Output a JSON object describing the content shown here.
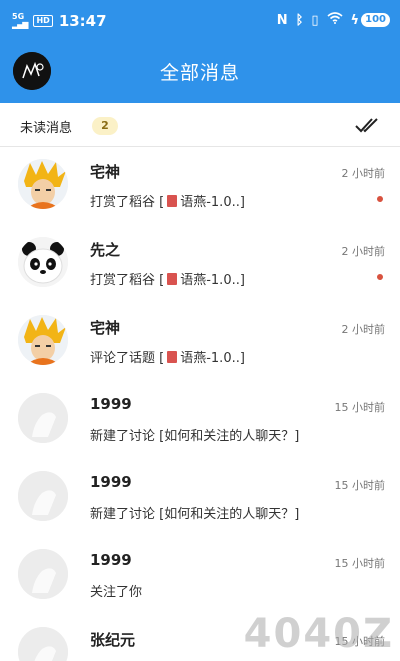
{
  "status_bar": {
    "network": "5G",
    "hd": "HD",
    "time": "13:47",
    "icons": [
      "nfc-icon",
      "bluetooth-icon",
      "vibrate-icon",
      "wifi-icon",
      "charging-icon"
    ],
    "battery": "100"
  },
  "header": {
    "title": "全部消息",
    "accent_color": "#2f92ea"
  },
  "unread": {
    "label": "未读消息",
    "count": "2",
    "mark_all_icon": "double-check-icon"
  },
  "messages": [
    {
      "name": "宅神",
      "time": "2 小时前",
      "prefix": "打赏了稻谷 [",
      "suffix": "语燕-1.0..]",
      "unread": true,
      "avatar": "anime-avatar"
    },
    {
      "name": "先之",
      "time": "2 小时前",
      "prefix": "打赏了稻谷 [",
      "suffix": "语燕-1.0..]",
      "unread": true,
      "avatar": "panda-avatar"
    },
    {
      "name": "宅神",
      "time": "2 小时前",
      "prefix": "评论了话题 [",
      "suffix": "语燕-1.0..]",
      "unread": false,
      "avatar": "anime-avatar"
    },
    {
      "name": "1999",
      "time": "15 小时前",
      "prefix": "新建了讨论 [如何和关注的人聊天？]",
      "suffix": "",
      "unread": false,
      "avatar": "default-avatar"
    },
    {
      "name": "1999",
      "time": "15 小时前",
      "prefix": "新建了讨论 [如何和关注的人聊天？]",
      "suffix": "",
      "unread": false,
      "avatar": "default-avatar"
    },
    {
      "name": "1999",
      "time": "15 小时前",
      "prefix": "关注了你",
      "suffix": "",
      "unread": false,
      "avatar": "default-avatar"
    },
    {
      "name": "张纪元",
      "time": "15 小时前",
      "prefix": "",
      "suffix": "",
      "unread": false,
      "avatar": "default-avatar"
    }
  ],
  "watermark": "4040Z"
}
